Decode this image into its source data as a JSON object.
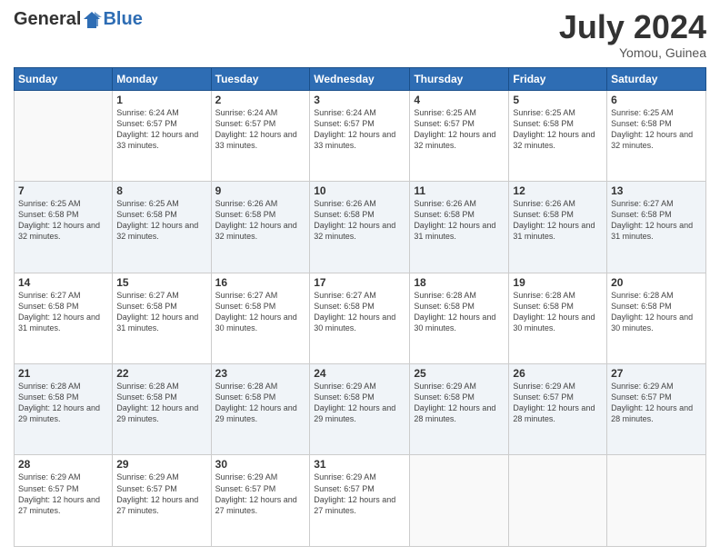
{
  "header": {
    "logo_general": "General",
    "logo_blue": "Blue",
    "month_year": "July 2024",
    "location": "Yomou, Guinea"
  },
  "days_of_week": [
    "Sunday",
    "Monday",
    "Tuesday",
    "Wednesday",
    "Thursday",
    "Friday",
    "Saturday"
  ],
  "weeks": [
    [
      {
        "day": "",
        "sunrise": "",
        "sunset": "",
        "daylight": ""
      },
      {
        "day": "1",
        "sunrise": "Sunrise: 6:24 AM",
        "sunset": "Sunset: 6:57 PM",
        "daylight": "Daylight: 12 hours and 33 minutes."
      },
      {
        "day": "2",
        "sunrise": "Sunrise: 6:24 AM",
        "sunset": "Sunset: 6:57 PM",
        "daylight": "Daylight: 12 hours and 33 minutes."
      },
      {
        "day": "3",
        "sunrise": "Sunrise: 6:24 AM",
        "sunset": "Sunset: 6:57 PM",
        "daylight": "Daylight: 12 hours and 33 minutes."
      },
      {
        "day": "4",
        "sunrise": "Sunrise: 6:25 AM",
        "sunset": "Sunset: 6:57 PM",
        "daylight": "Daylight: 12 hours and 32 minutes."
      },
      {
        "day": "5",
        "sunrise": "Sunrise: 6:25 AM",
        "sunset": "Sunset: 6:58 PM",
        "daylight": "Daylight: 12 hours and 32 minutes."
      },
      {
        "day": "6",
        "sunrise": "Sunrise: 6:25 AM",
        "sunset": "Sunset: 6:58 PM",
        "daylight": "Daylight: 12 hours and 32 minutes."
      }
    ],
    [
      {
        "day": "7",
        "sunrise": "Sunrise: 6:25 AM",
        "sunset": "Sunset: 6:58 PM",
        "daylight": "Daylight: 12 hours and 32 minutes."
      },
      {
        "day": "8",
        "sunrise": "Sunrise: 6:25 AM",
        "sunset": "Sunset: 6:58 PM",
        "daylight": "Daylight: 12 hours and 32 minutes."
      },
      {
        "day": "9",
        "sunrise": "Sunrise: 6:26 AM",
        "sunset": "Sunset: 6:58 PM",
        "daylight": "Daylight: 12 hours and 32 minutes."
      },
      {
        "day": "10",
        "sunrise": "Sunrise: 6:26 AM",
        "sunset": "Sunset: 6:58 PM",
        "daylight": "Daylight: 12 hours and 32 minutes."
      },
      {
        "day": "11",
        "sunrise": "Sunrise: 6:26 AM",
        "sunset": "Sunset: 6:58 PM",
        "daylight": "Daylight: 12 hours and 31 minutes."
      },
      {
        "day": "12",
        "sunrise": "Sunrise: 6:26 AM",
        "sunset": "Sunset: 6:58 PM",
        "daylight": "Daylight: 12 hours and 31 minutes."
      },
      {
        "day": "13",
        "sunrise": "Sunrise: 6:27 AM",
        "sunset": "Sunset: 6:58 PM",
        "daylight": "Daylight: 12 hours and 31 minutes."
      }
    ],
    [
      {
        "day": "14",
        "sunrise": "Sunrise: 6:27 AM",
        "sunset": "Sunset: 6:58 PM",
        "daylight": "Daylight: 12 hours and 31 minutes."
      },
      {
        "day": "15",
        "sunrise": "Sunrise: 6:27 AM",
        "sunset": "Sunset: 6:58 PM",
        "daylight": "Daylight: 12 hours and 31 minutes."
      },
      {
        "day": "16",
        "sunrise": "Sunrise: 6:27 AM",
        "sunset": "Sunset: 6:58 PM",
        "daylight": "Daylight: 12 hours and 30 minutes."
      },
      {
        "day": "17",
        "sunrise": "Sunrise: 6:27 AM",
        "sunset": "Sunset: 6:58 PM",
        "daylight": "Daylight: 12 hours and 30 minutes."
      },
      {
        "day": "18",
        "sunrise": "Sunrise: 6:28 AM",
        "sunset": "Sunset: 6:58 PM",
        "daylight": "Daylight: 12 hours and 30 minutes."
      },
      {
        "day": "19",
        "sunrise": "Sunrise: 6:28 AM",
        "sunset": "Sunset: 6:58 PM",
        "daylight": "Daylight: 12 hours and 30 minutes."
      },
      {
        "day": "20",
        "sunrise": "Sunrise: 6:28 AM",
        "sunset": "Sunset: 6:58 PM",
        "daylight": "Daylight: 12 hours and 30 minutes."
      }
    ],
    [
      {
        "day": "21",
        "sunrise": "Sunrise: 6:28 AM",
        "sunset": "Sunset: 6:58 PM",
        "daylight": "Daylight: 12 hours and 29 minutes."
      },
      {
        "day": "22",
        "sunrise": "Sunrise: 6:28 AM",
        "sunset": "Sunset: 6:58 PM",
        "daylight": "Daylight: 12 hours and 29 minutes."
      },
      {
        "day": "23",
        "sunrise": "Sunrise: 6:28 AM",
        "sunset": "Sunset: 6:58 PM",
        "daylight": "Daylight: 12 hours and 29 minutes."
      },
      {
        "day": "24",
        "sunrise": "Sunrise: 6:29 AM",
        "sunset": "Sunset: 6:58 PM",
        "daylight": "Daylight: 12 hours and 29 minutes."
      },
      {
        "day": "25",
        "sunrise": "Sunrise: 6:29 AM",
        "sunset": "Sunset: 6:58 PM",
        "daylight": "Daylight: 12 hours and 28 minutes."
      },
      {
        "day": "26",
        "sunrise": "Sunrise: 6:29 AM",
        "sunset": "Sunset: 6:57 PM",
        "daylight": "Daylight: 12 hours and 28 minutes."
      },
      {
        "day": "27",
        "sunrise": "Sunrise: 6:29 AM",
        "sunset": "Sunset: 6:57 PM",
        "daylight": "Daylight: 12 hours and 28 minutes."
      }
    ],
    [
      {
        "day": "28",
        "sunrise": "Sunrise: 6:29 AM",
        "sunset": "Sunset: 6:57 PM",
        "daylight": "Daylight: 12 hours and 27 minutes."
      },
      {
        "day": "29",
        "sunrise": "Sunrise: 6:29 AM",
        "sunset": "Sunset: 6:57 PM",
        "daylight": "Daylight: 12 hours and 27 minutes."
      },
      {
        "day": "30",
        "sunrise": "Sunrise: 6:29 AM",
        "sunset": "Sunset: 6:57 PM",
        "daylight": "Daylight: 12 hours and 27 minutes."
      },
      {
        "day": "31",
        "sunrise": "Sunrise: 6:29 AM",
        "sunset": "Sunset: 6:57 PM",
        "daylight": "Daylight: 12 hours and 27 minutes."
      },
      {
        "day": "",
        "sunrise": "",
        "sunset": "",
        "daylight": ""
      },
      {
        "day": "",
        "sunrise": "",
        "sunset": "",
        "daylight": ""
      },
      {
        "day": "",
        "sunrise": "",
        "sunset": "",
        "daylight": ""
      }
    ]
  ]
}
